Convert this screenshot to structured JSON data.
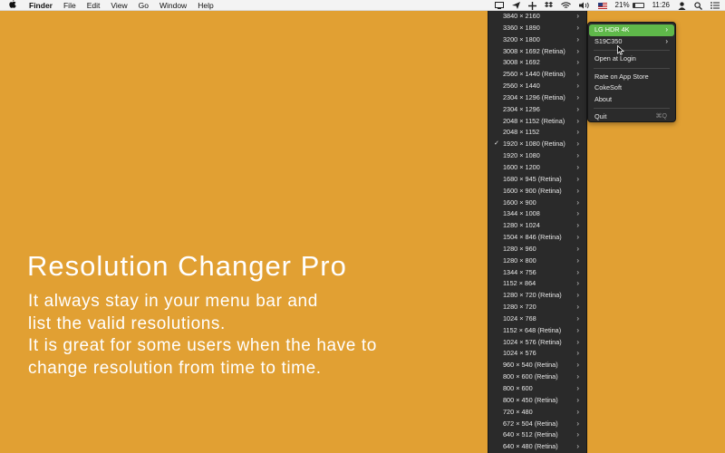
{
  "menubar": {
    "app_name": "Finder",
    "items": [
      "File",
      "Edit",
      "View",
      "Go",
      "Window",
      "Help"
    ],
    "battery_percent": "21%",
    "clock": "11:26"
  },
  "promo": {
    "title": "Resolution Changer Pro",
    "lines": [
      "It always stay in your menu bar and",
      "list the valid resolutions.",
      "It is great for some users when the have to",
      "change resolution from time to time."
    ]
  },
  "resolution_menu": {
    "items": [
      {
        "label": "3840 × 2160"
      },
      {
        "label": "3360 × 1890"
      },
      {
        "label": "3200 × 1800"
      },
      {
        "label": "3008 × 1692 (Retina)"
      },
      {
        "label": "3008 × 1692"
      },
      {
        "label": "2560 × 1440 (Retina)"
      },
      {
        "label": "2560 × 1440"
      },
      {
        "label": "2304 × 1296 (Retina)"
      },
      {
        "label": "2304 × 1296"
      },
      {
        "label": "2048 × 1152 (Retina)"
      },
      {
        "label": "2048 × 1152"
      },
      {
        "label": "1920 × 1080 (Retina)",
        "checked": true
      },
      {
        "label": "1920 × 1080"
      },
      {
        "label": "1600 × 1200"
      },
      {
        "label": "1680 × 945 (Retina)"
      },
      {
        "label": "1600 × 900 (Retina)"
      },
      {
        "label": "1600 × 900"
      },
      {
        "label": "1344 × 1008"
      },
      {
        "label": "1280 × 1024"
      },
      {
        "label": "1504 × 846 (Retina)"
      },
      {
        "label": "1280 × 960"
      },
      {
        "label": "1280 × 800"
      },
      {
        "label": "1344 × 756"
      },
      {
        "label": "1152 × 864"
      },
      {
        "label": "1280 × 720 (Retina)"
      },
      {
        "label": "1280 × 720"
      },
      {
        "label": "1024 × 768"
      },
      {
        "label": "1152 × 648 (Retina)"
      },
      {
        "label": "1024 × 576 (Retina)"
      },
      {
        "label": "1024 × 576"
      },
      {
        "label": "960 × 540 (Retina)"
      },
      {
        "label": "800 × 600 (Retina)"
      },
      {
        "label": "800 × 600"
      },
      {
        "label": "800 × 450 (Retina)"
      },
      {
        "label": "720 × 480"
      },
      {
        "label": "672 × 504 (Retina)"
      },
      {
        "label": "640 × 512 (Retina)"
      },
      {
        "label": "640 × 480 (Retina)"
      }
    ]
  },
  "app_menu": {
    "displays": [
      "LG HDR 4K",
      "S19C350"
    ],
    "selected_display": "LG HDR 4K",
    "open_at_login": "Open at Login",
    "rate": "Rate on App Store",
    "cokesoft": "CokeSoft",
    "about": "About",
    "quit": "Quit",
    "quit_shortcut": "⌘Q"
  },
  "colors": {
    "background": "#e1a033",
    "menu_bg": "#2a2a2a",
    "selection": "#5fb84a"
  }
}
